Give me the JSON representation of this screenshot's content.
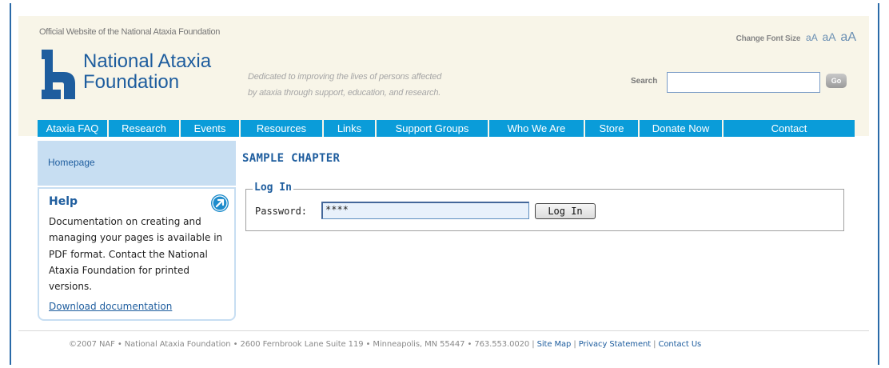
{
  "header": {
    "official_text": "Official Website of the National Ataxia Foundation",
    "font_size_label": "Change Font Size",
    "font_size_small": "aA",
    "font_size_medium": "aA",
    "font_size_large": "aA",
    "logo_line1": "National Ataxia",
    "logo_line2": "Foundation",
    "tagline_line1": "Dedicated to improving the lives of persons affected",
    "tagline_line2": "by ataxia through support, education, and research.",
    "search_label": "Search",
    "search_value": "",
    "go_label": "Go"
  },
  "nav": {
    "items": [
      {
        "label": "Ataxia FAQ"
      },
      {
        "label": "Research"
      },
      {
        "label": "Events"
      },
      {
        "label": "Resources"
      },
      {
        "label": "Links"
      },
      {
        "label": "Support Groups"
      },
      {
        "label": "Who We Are"
      },
      {
        "label": "Store"
      },
      {
        "label": "Donate Now"
      },
      {
        "label": "Contact"
      }
    ]
  },
  "sidebar": {
    "homepage_label": "Homepage",
    "help_title": "Help",
    "help_body": "Documentation on creating and managing your pages is available in PDF format. Contact the National Ataxia Foundation for printed versions.",
    "download_link": "Download documentation"
  },
  "main": {
    "page_title": "SAMPLE CHAPTER",
    "login_legend": "Log In",
    "password_label": "Password:",
    "password_value": "****",
    "login_button": "Log In"
  },
  "footer": {
    "copyright": "©2007 NAF • National Ataxia Foundation • 2600 Fernbrook Lane Suite 119 • Minneapolis, MN 55447 • 763.553.0020",
    "site_map": "Site Map",
    "privacy": "Privacy Statement",
    "contact": "Contact Us",
    "divider": "|"
  },
  "colors": {
    "brand_blue": "#1e5d9e",
    "nav_blue": "#0a9cd9",
    "header_bg": "#f8f5e8",
    "sidebar_bg": "#c7def2"
  }
}
